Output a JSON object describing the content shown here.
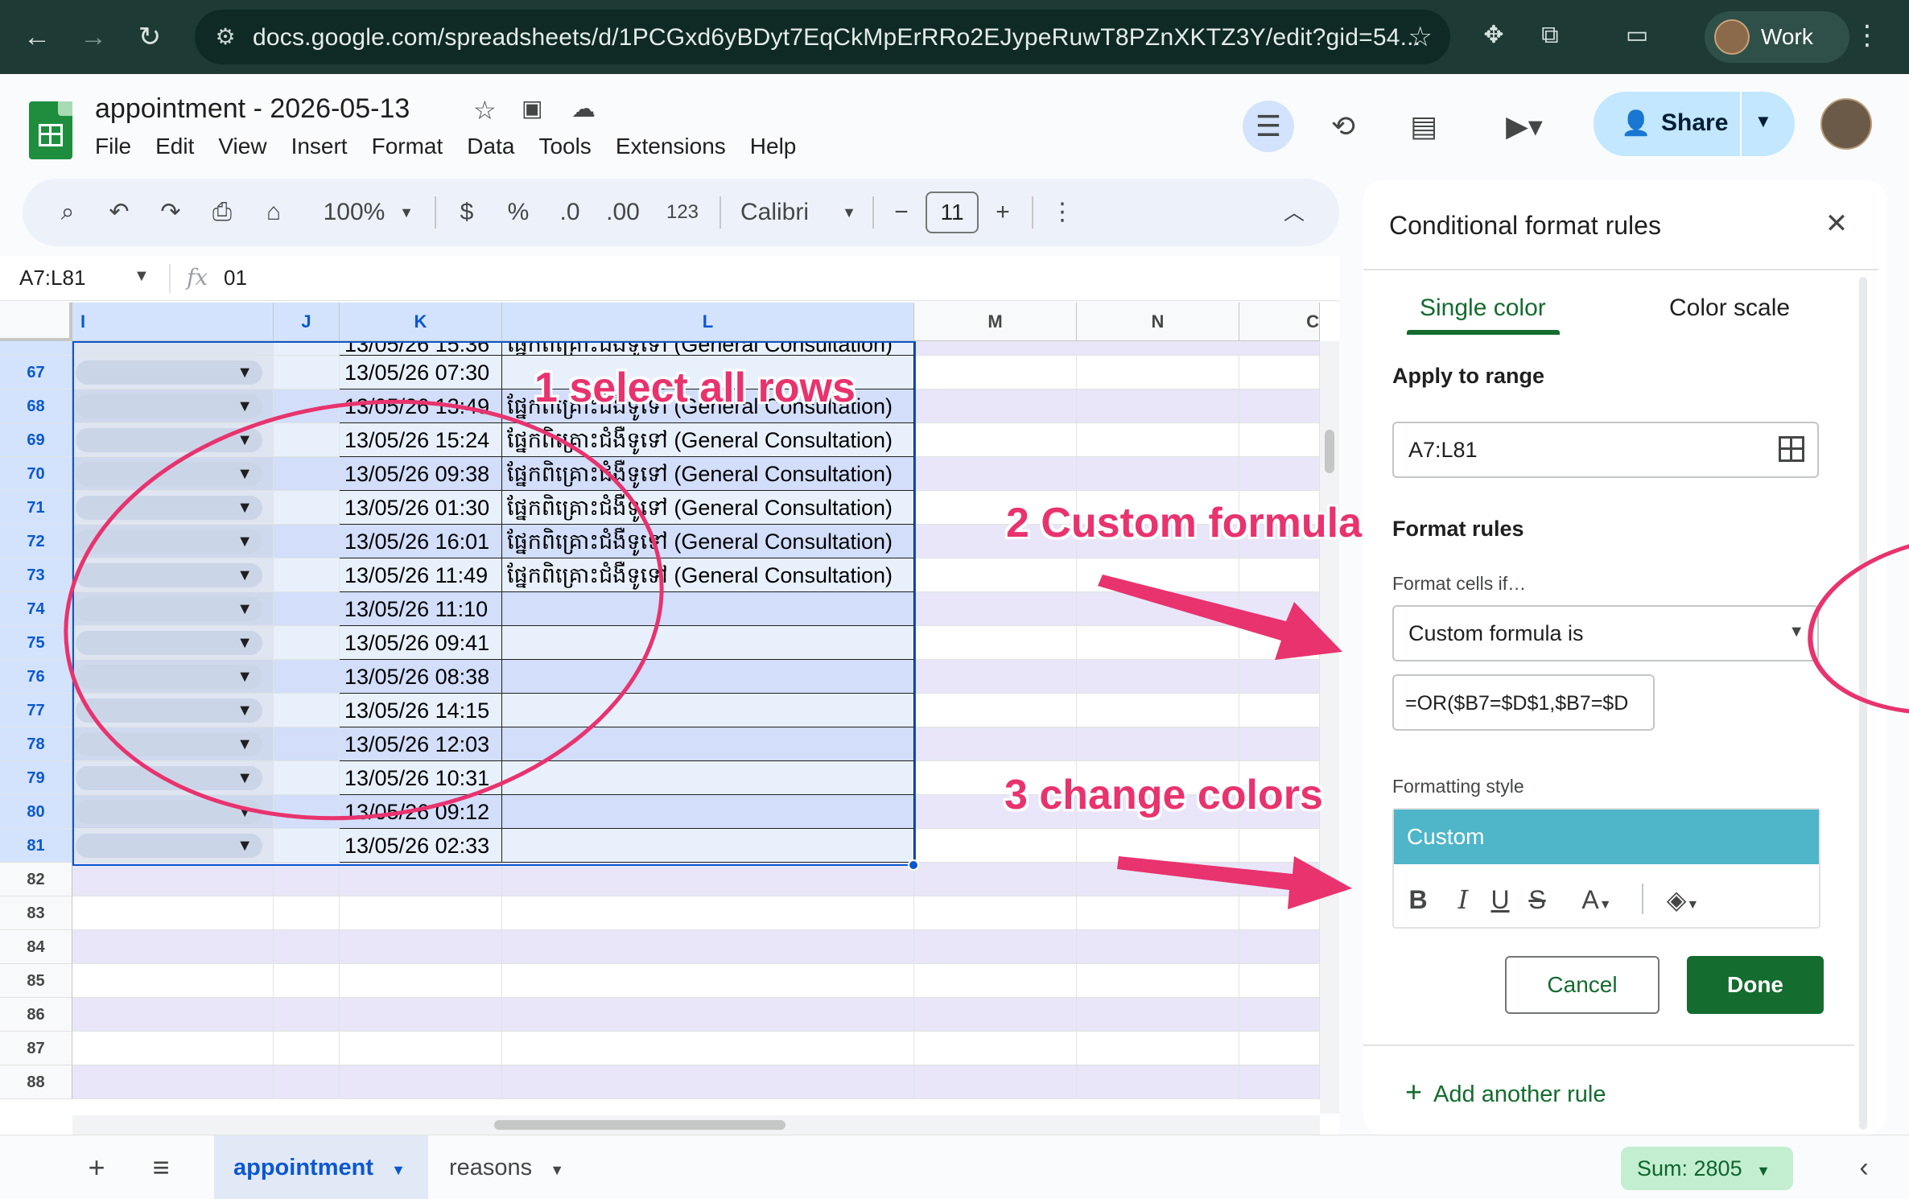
{
  "browser": {
    "url": "docs.google.com/spreadsheets/d/1PCGxd6yBDyt7EqCkMpErRRo2EJypeRuwT8PZnXKTZ3Y/edit?gid=54...",
    "profile": "Work"
  },
  "app": {
    "doc_title": "appointment - 2026-05-13",
    "menus": [
      "File",
      "Edit",
      "View",
      "Insert",
      "Format",
      "Data",
      "Tools",
      "Extensions",
      "Help"
    ],
    "share_label": "Share"
  },
  "toolbar": {
    "zoom": "100%",
    "currency": "$",
    "percent": "%",
    "dec_decrease": ".0",
    "dec_increase": ".00",
    "number_format": "123",
    "font": "Calibri",
    "font_size": "11",
    "minus": "−",
    "plus": "+"
  },
  "formula_bar": {
    "name_box": "A7:L81",
    "fx": "fx",
    "value": "01"
  },
  "grid": {
    "columns": [
      "I",
      "J",
      "K",
      "L",
      "M",
      "N",
      "C"
    ],
    "rows": [
      {
        "num": "67",
        "k": "13/05/26 07:30",
        "l": "",
        "sel": true,
        "band": "even"
      },
      {
        "num": "68",
        "k": "13/05/26 13:49",
        "l": "ផ្នែកពិគ្រោះជំងឺទូទៅ (General Consultation)",
        "sel": true,
        "band": "odd"
      },
      {
        "num": "69",
        "k": "13/05/26 15:24",
        "l": "ផ្នែកពិគ្រោះជំងឺទូទៅ (General Consultation)",
        "sel": true,
        "band": "even"
      },
      {
        "num": "70",
        "k": "13/05/26 09:38",
        "l": "ផ្នែកពិគ្រោះជំងឺទូទៅ (General Consultation)",
        "sel": true,
        "band": "odd"
      },
      {
        "num": "71",
        "k": "13/05/26 01:30",
        "l": "ផ្នែកពិគ្រោះជំងឺទូទៅ (General Consultation)",
        "sel": true,
        "band": "even"
      },
      {
        "num": "72",
        "k": "13/05/26 16:01",
        "l": "ផ្នែកពិគ្រោះជំងឺទូទៅ (General Consultation)",
        "sel": true,
        "band": "odd"
      },
      {
        "num": "73",
        "k": "13/05/26 11:49",
        "l": "ផ្នែកពិគ្រោះជំងឺទូទៅ (General Consultation)",
        "sel": true,
        "band": "even"
      },
      {
        "num": "74",
        "k": "13/05/26 11:10",
        "l": "",
        "sel": true,
        "band": "odd"
      },
      {
        "num": "75",
        "k": "13/05/26 09:41",
        "l": "",
        "sel": true,
        "band": "even"
      },
      {
        "num": "76",
        "k": "13/05/26 08:38",
        "l": "",
        "sel": true,
        "band": "odd"
      },
      {
        "num": "77",
        "k": "13/05/26 14:15",
        "l": "",
        "sel": true,
        "band": "even"
      },
      {
        "num": "78",
        "k": "13/05/26 12:03",
        "l": "",
        "sel": true,
        "band": "odd"
      },
      {
        "num": "79",
        "k": "13/05/26 10:31",
        "l": "",
        "sel": true,
        "band": "even"
      },
      {
        "num": "80",
        "k": "13/05/26 09:12",
        "l": "",
        "sel": true,
        "band": "odd"
      },
      {
        "num": "81",
        "k": "13/05/26 02:33",
        "l": "",
        "sel": true,
        "band": "even"
      },
      {
        "num": "82",
        "k": "",
        "l": "",
        "sel": false,
        "band": "odd"
      },
      {
        "num": "83",
        "k": "",
        "l": "",
        "sel": false,
        "band": "even"
      },
      {
        "num": "84",
        "k": "",
        "l": "",
        "sel": false,
        "band": "odd"
      },
      {
        "num": "85",
        "k": "",
        "l": "",
        "sel": false,
        "band": "even"
      },
      {
        "num": "86",
        "k": "",
        "l": "",
        "sel": false,
        "band": "odd"
      },
      {
        "num": "87",
        "k": "",
        "l": "",
        "sel": false,
        "band": "even"
      },
      {
        "num": "88",
        "k": "",
        "l": "",
        "sel": false,
        "band": "odd"
      }
    ]
  },
  "annotations": {
    "step1": "1 select all rows",
    "step2": "2 Custom formula",
    "step3": "3 change colors",
    "color": "#e8336e"
  },
  "panel": {
    "title": "Conditional format rules",
    "tabs": [
      "Single color",
      "Color scale"
    ],
    "apply_to_range_label": "Apply to range",
    "range_value": "A7:L81",
    "format_rules_label": "Format rules",
    "format_cells_if_label": "Format cells if…",
    "condition": "Custom formula is",
    "formula": "=OR($B7=$D$1,$B7=$D",
    "formatting_style_label": "Formatting style",
    "style_preview": "Custom",
    "cancel": "Cancel",
    "done": "Done",
    "add_rule": "Add another rule",
    "accent": "#146c2e",
    "style_color": "#4fb5c9"
  },
  "bottom": {
    "sheets": [
      "appointment",
      "reasons"
    ],
    "sum": "Sum: 2805"
  }
}
